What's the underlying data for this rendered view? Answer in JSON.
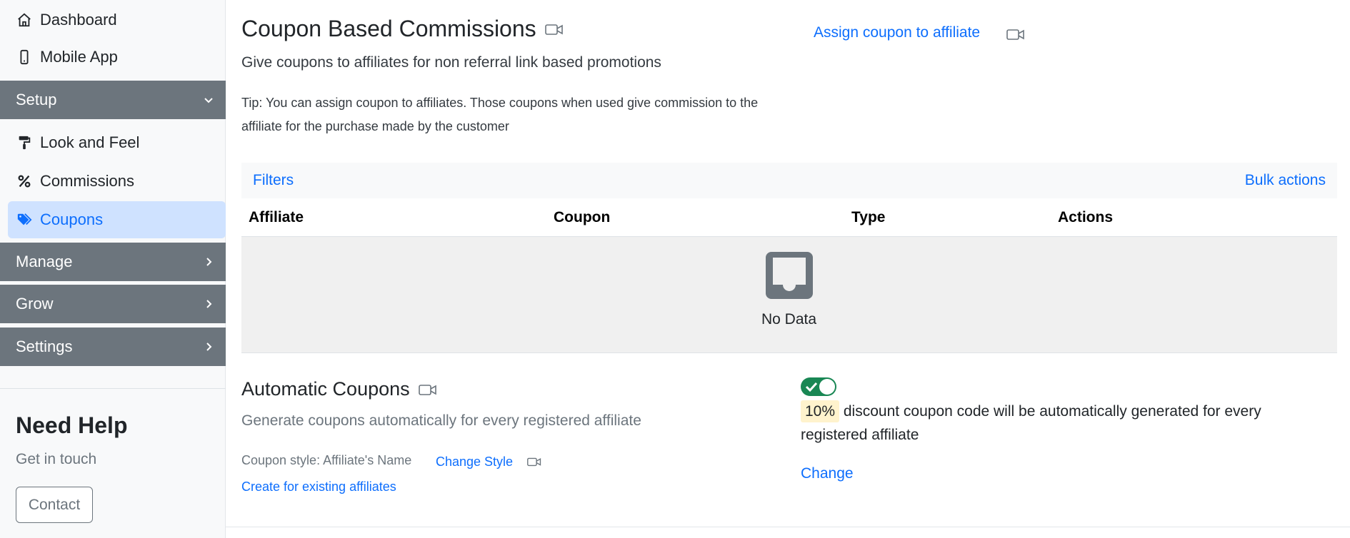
{
  "sidebar": {
    "top_items": [
      {
        "label": "Dashboard",
        "icon": "home-icon"
      },
      {
        "label": "Mobile App",
        "icon": "phone-icon"
      }
    ],
    "setup": {
      "label": "Setup",
      "icon": "chevron-down-icon"
    },
    "setup_items": [
      {
        "label": "Look and Feel",
        "icon": "paint-roller-icon"
      },
      {
        "label": "Commissions",
        "icon": "percent-icon"
      },
      {
        "label": "Coupons",
        "icon": "tags-icon",
        "active": true
      }
    ],
    "sections": [
      {
        "label": "Manage",
        "icon": "chevron-right-icon"
      },
      {
        "label": "Grow",
        "icon": "chevron-right-icon"
      },
      {
        "label": "Settings",
        "icon": "chevron-right-icon"
      }
    ],
    "help": {
      "title": "Need Help",
      "subtitle": "Get in touch",
      "contact_label": "Contact"
    }
  },
  "coupon_section": {
    "title": "Coupon Based Commissions",
    "subtitle": "Give coupons to affiliates for non referral link based promotions",
    "tip": "Tip: You can assign coupon to affiliates. Those coupons when used give commission to the affiliate for the purchase made by the customer",
    "assign_link": "Assign coupon to affiliate"
  },
  "table": {
    "filters_label": "Filters",
    "bulk_actions_label": "Bulk actions",
    "columns": [
      "Affiliate",
      "Coupon",
      "Type",
      "Actions"
    ],
    "empty_text": "No Data"
  },
  "auto_section": {
    "title": "Automatic Coupons",
    "subtitle": "Generate coupons automatically for every registered affiliate",
    "style_label": "Coupon style: Affiliate's Name",
    "change_style": "Change Style",
    "create_existing": "Create for existing affiliates",
    "toggle_on": true,
    "discount": "10%",
    "description": " discount coupon code will be automatically generated for every registered affiliate",
    "change_label": "Change"
  },
  "colors": {
    "link": "#0d6efd",
    "section_header": "#6c757d",
    "active_bg": "#cfe2ff",
    "toggle_on": "#198754",
    "highlight": "#fff3cd"
  }
}
